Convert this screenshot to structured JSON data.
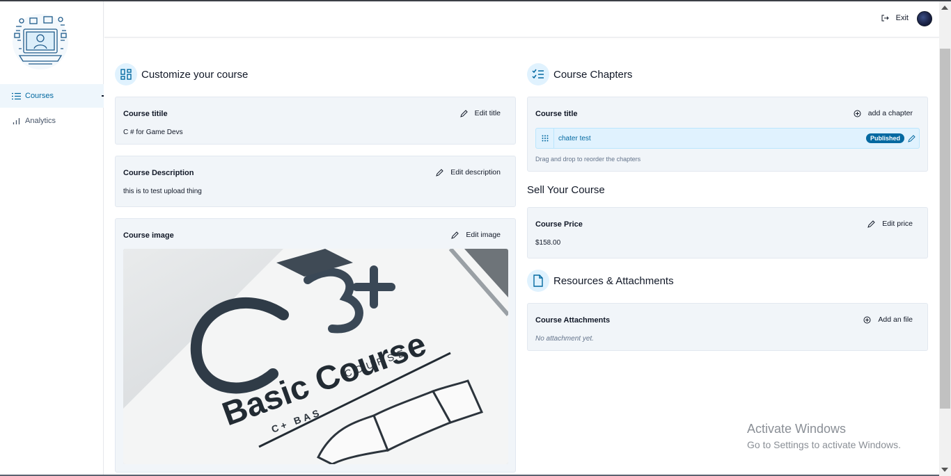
{
  "sidebar": {
    "items": [
      {
        "label": "Courses",
        "icon": "list-icon",
        "active": true
      },
      {
        "label": "Analytics",
        "icon": "bar-chart-icon",
        "active": false
      }
    ]
  },
  "header": {
    "exit_label": "Exit"
  },
  "left": {
    "section_title": "Customize your course",
    "title_card": {
      "label": "Course titile",
      "action": "Edit title",
      "value": "C # for Game Devs"
    },
    "description_card": {
      "label": "Course Description",
      "action": "Edit description",
      "value": "this is to test upload thing"
    },
    "image_card": {
      "label": "Course image",
      "action": "Edit image",
      "image_text": {
        "big": "Basic Course",
        "small": "COURSE",
        "strip": "C+ BAS"
      }
    }
  },
  "right": {
    "chapters_title": "Course Chapters",
    "chapters_card": {
      "label": "Course title",
      "action": "add a chapter",
      "chapters": [
        {
          "name": "chater test",
          "status": "Published"
        }
      ],
      "hint": "Drag and drop to reorder the chapters"
    },
    "sell_title": "Sell Your Course",
    "price_card": {
      "label": "Course Price",
      "action": "Edit price",
      "value": "$158.00"
    },
    "resources_title": "Resources & Attachments",
    "attachments_card": {
      "label": "Course Attachments",
      "action": "Add an file",
      "empty": "No attachment yet."
    }
  },
  "watermark": {
    "line1": "Activate Windows",
    "line2": "Go to Settings to activate Windows."
  },
  "colors": {
    "accent": "#0369a1",
    "accent_light": "#e0f2fe",
    "card_bg": "#f1f5f9"
  }
}
